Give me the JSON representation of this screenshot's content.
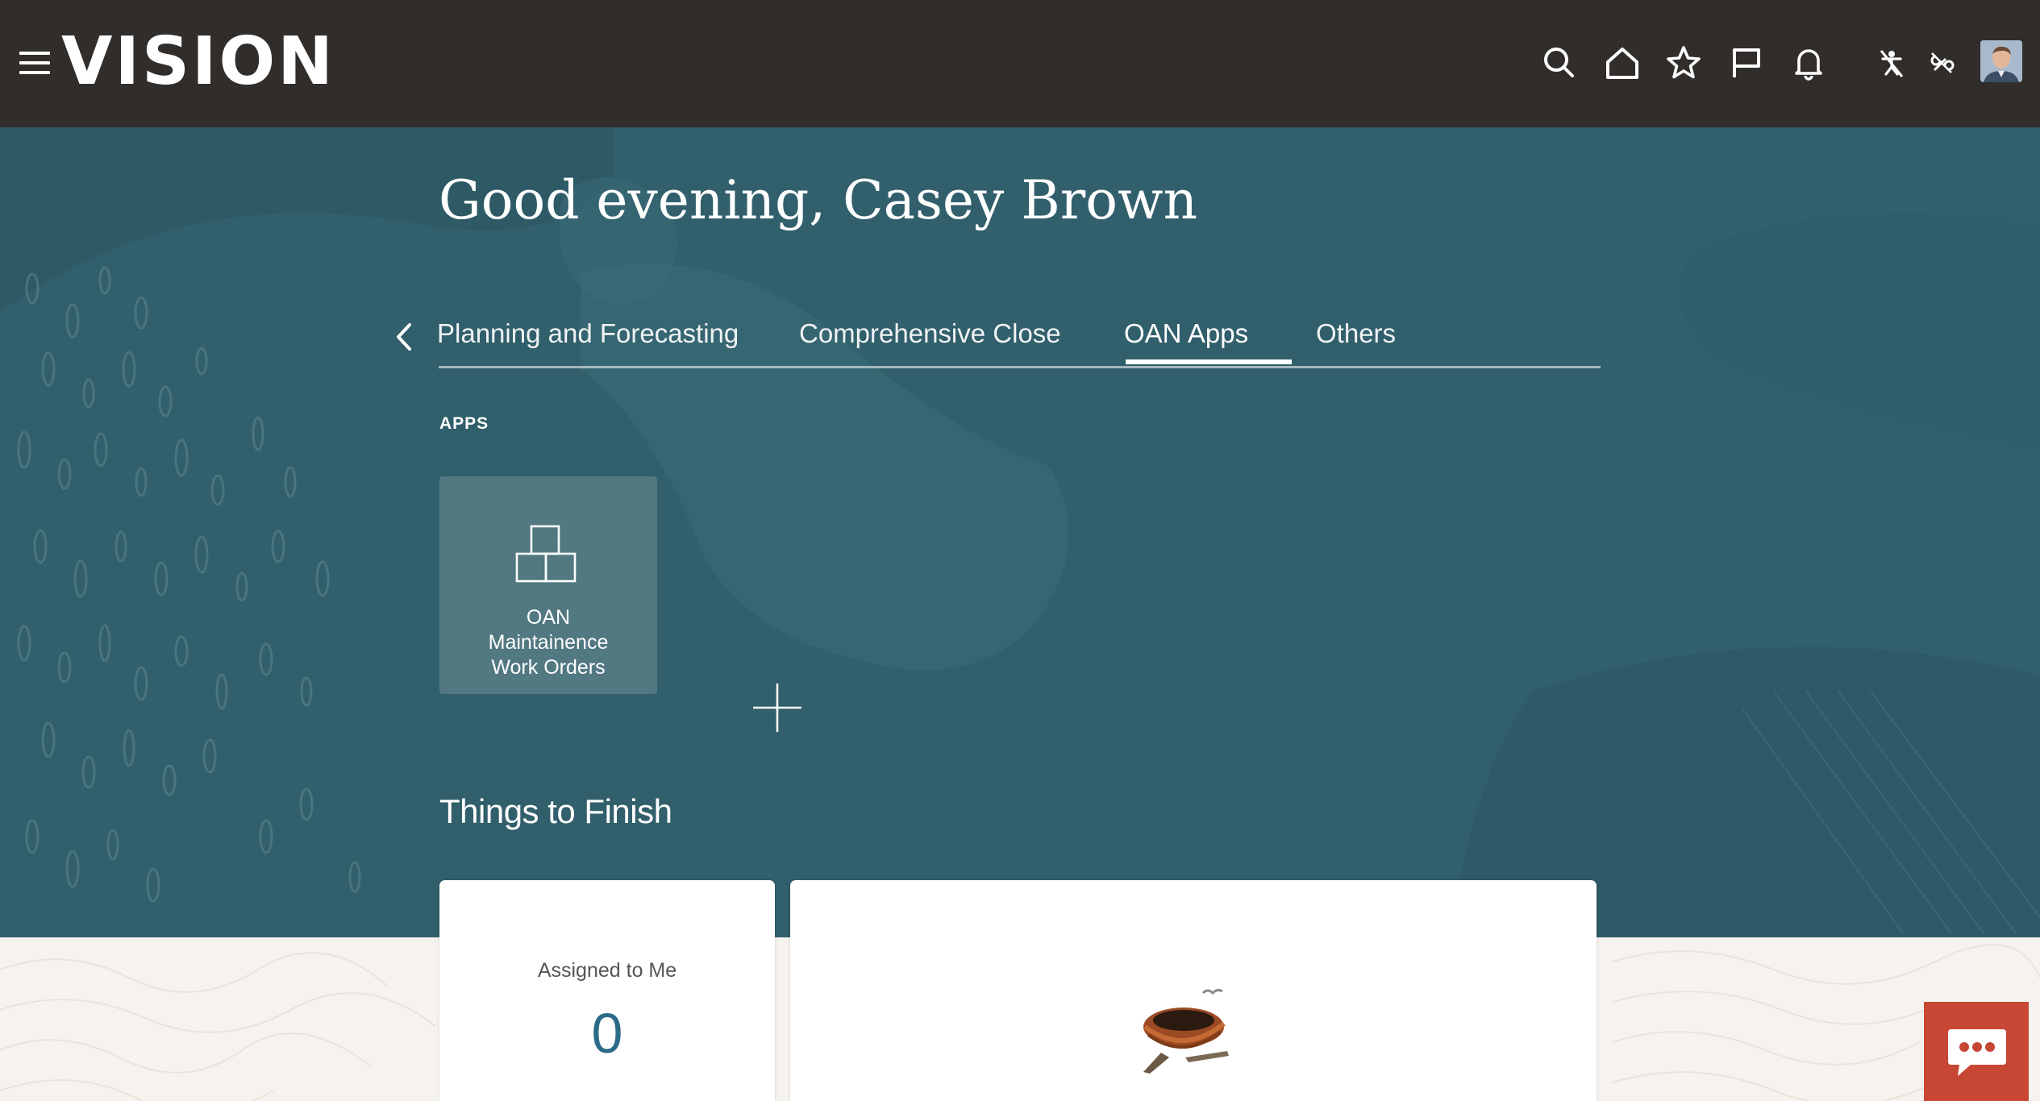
{
  "app": {
    "logo_text": "VISION"
  },
  "header": {
    "icons": [
      "search-icon",
      "home-icon",
      "favorites-star-icon",
      "flag-icon",
      "notifications-bell-icon",
      "accessibility-off-icon",
      "tools-off-icon"
    ],
    "avatar": "user-avatar"
  },
  "hero": {
    "greeting": "Good evening, Casey Brown",
    "tabs": [
      {
        "label": "Planning and Forecasting",
        "active": false
      },
      {
        "label": "Comprehensive Close",
        "active": false
      },
      {
        "label": "OAN Apps",
        "active": true
      },
      {
        "label": "Others",
        "active": false
      }
    ],
    "apps_section_label": "APPS",
    "apps": [
      {
        "label_lines": [
          "OAN",
          "Maintainence",
          "Work Orders"
        ],
        "icon": "stacked-boxes-icon"
      }
    ],
    "add_app_icon": "plus-icon"
  },
  "things_to_finish": {
    "title": "Things to Finish",
    "assigned_to_me": {
      "label": "Assigned to Me",
      "count": "0"
    },
    "empty_state_icon": "nest-illustration"
  },
  "colors": {
    "header_bg": "#312d2a",
    "hero_bg": "#315f6b",
    "accent_count": "#2c6b87",
    "chat_button_bg": "#c74634"
  },
  "chat": {
    "icon": "chat-bubble-icon"
  }
}
